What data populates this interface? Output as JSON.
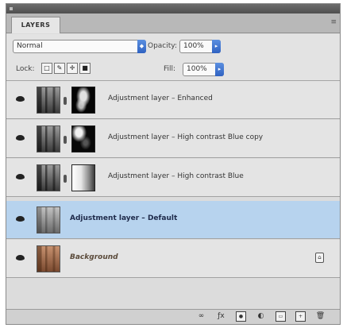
{
  "panel": {
    "tab_label": "LAYERS",
    "menu_glyph": "≡"
  },
  "controls": {
    "blend_mode": "Normal",
    "opacity_label": "Opacity:",
    "opacity_value": "100%",
    "lock_label": "Lock:",
    "fill_label": "Fill:",
    "fill_value": "100%"
  },
  "layers": [
    {
      "name": "Adjustment layer – Enhanced",
      "selected": false
    },
    {
      "name": "Adjustment layer – High contrast Blue copy",
      "selected": false
    },
    {
      "name": "Adjustment layer – High contrast Blue",
      "selected": false
    },
    {
      "name": "Adjustment layer – Default",
      "selected": true
    },
    {
      "name": "Background",
      "selected": false
    }
  ],
  "colors": {
    "selection": "#b7d3ee",
    "panel_bg": "#dcdcdc",
    "accent_blue": "#2f62c2"
  },
  "icons": {
    "lock_icons": [
      "lock-transparent-icon",
      "lock-paint-icon",
      "lock-move-icon",
      "lock-all-icon"
    ],
    "bottom_icons": [
      "link-layers-icon",
      "fx-icon",
      "add-mask-icon",
      "adjustment-icon",
      "group-icon",
      "new-layer-icon",
      "trash-icon"
    ]
  }
}
